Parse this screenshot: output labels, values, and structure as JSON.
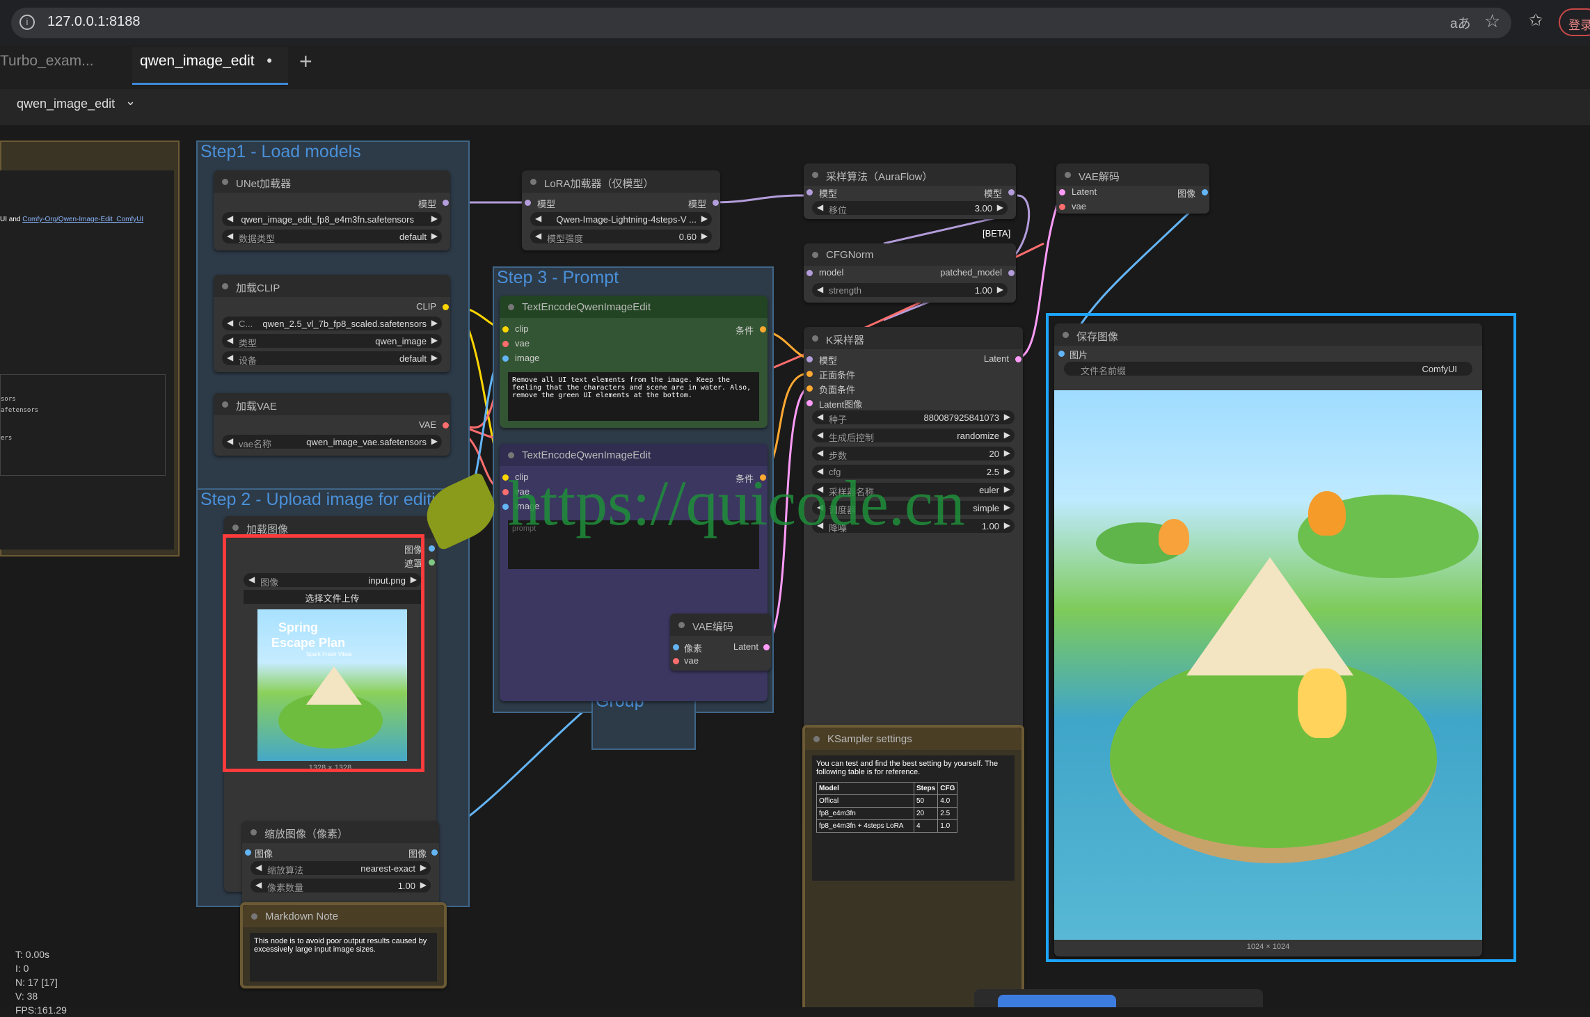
{
  "browser": {
    "url": "127.0.0.1:8188",
    "translate_icon": "aあ",
    "login_label": "登录"
  },
  "tabs": [
    {
      "label": "Turbo_exam..."
    },
    {
      "label": "qwen_image_edit",
      "dirty_mark": "●"
    }
  ],
  "new_tab_label": "+",
  "workflow_menu": {
    "label": "qwen_image_edit",
    "chevron": "⌄"
  },
  "groups": {
    "step1": "Step1 - Load models",
    "step2": "Step 2 - Upload image for editi",
    "step3": "Step 3 - Prompt",
    "group": "Group"
  },
  "left_note": {
    "text_before": "UI and ",
    "link": "Comfy-Org/Qwen-Image-Edit_ComfyUI",
    "lines": [
      "sors",
      "afetensors",
      "ers"
    ]
  },
  "unet": {
    "title": "UNet加载器",
    "out": "模型",
    "name_value": "qwen_image_edit_fp8_e4m3fn.safetensors",
    "dtype_label": "数据类型",
    "dtype_value": "default"
  },
  "clip_loader": {
    "title": "加载CLIP",
    "out": "CLIP",
    "name_label": "C...",
    "name_value": "qwen_2.5_vl_7b_fp8_scaled.safetensors",
    "type_label": "类型",
    "type_value": "qwen_image",
    "device_label": "设备",
    "device_value": "default"
  },
  "vae_loader": {
    "title": "加载VAE",
    "out": "VAE",
    "name_label": "vae名称",
    "name_value": "qwen_image_vae.safetensors"
  },
  "lora": {
    "title": "LoRA加载器（仅模型）",
    "in": "模型",
    "out": "模型",
    "name_value": "Qwen-Image-Lightning-4steps-V ...",
    "strength_label": "模型强度",
    "strength_value": "0.60"
  },
  "sampling": {
    "title": "采样算法（AuraFlow）",
    "in": "模型",
    "out": "模型",
    "shift_label": "移位",
    "shift_value": "3.00",
    "badge": "[BETA]"
  },
  "cfgnorm": {
    "title": "CFGNorm",
    "in": "model",
    "out": "patched_model",
    "strength_label": "strength",
    "strength_value": "1.00"
  },
  "vaedecode": {
    "title": "VAE解码",
    "in1": "Latent",
    "in2": "vae",
    "out": "图像"
  },
  "text1": {
    "title": "TextEncodeQwenImageEdit",
    "in1": "clip",
    "in2": "vae",
    "in3": "image",
    "out": "条件",
    "prompt": "Remove all UI text elements from the image. Keep the feeling that the characters and scene are in water. Also, remove the green UI elements at the bottom."
  },
  "text2": {
    "title": "TextEncodeQwenImageEdit",
    "in1": "clip",
    "in2": "vae",
    "in3": "image",
    "out": "条件",
    "placeholder": "prompt"
  },
  "ksampler": {
    "title": "K采样器",
    "in1": "模型",
    "in2": "正面条件",
    "in3": "负面条件",
    "in4": "Latent图像",
    "out": "Latent",
    "seed_label": "种子",
    "seed_value": "880087925841073",
    "control_label": "生成后控制",
    "control_value": "randomize",
    "steps_label": "步数",
    "steps_value": "20",
    "cfg_label": "cfg",
    "cfg_value": "2.5",
    "sampler_label": "采样器名称",
    "sampler_value": "euler",
    "scheduler_label": "调度器",
    "scheduler_value": "simple",
    "denoise_label": "降噪",
    "denoise_value": "1.00"
  },
  "save": {
    "title": "保存图像",
    "in": "图片",
    "prefix_label": "文件名前缀",
    "prefix_value": "ComfyUI",
    "size": "1024 × 1024"
  },
  "load_image": {
    "title": "加载图像",
    "out1": "图像",
    "out2": "遮罩",
    "image_label": "图像",
    "image_value": "input.png",
    "upload_label": "选择文件上传",
    "size": "1328 × 1328",
    "poster_title1": "Spring",
    "poster_title2": "Escape Plan",
    "poster_sub": "Spark Fresh Vibes"
  },
  "vaeencode": {
    "title": "VAE编码",
    "in1": "像素",
    "in2": "vae",
    "out": "Latent"
  },
  "scale": {
    "title": "缩放图像（像素）",
    "in": "图像",
    "out": "图像",
    "method_label": "缩放算法",
    "method_value": "nearest-exact",
    "mp_label": "像素数量",
    "mp_value": "1.00"
  },
  "ks_settings": {
    "title": "KSampler settings",
    "intro": "You can test and find the best setting by yourself. The following table is for reference.",
    "headers": [
      "Model",
      "Steps",
      "CFG"
    ],
    "rows": [
      [
        "Offical",
        "50",
        "4.0"
      ],
      [
        "fp8_e4m3fn",
        "20",
        "2.5"
      ],
      [
        "fp8_e4m3fn + 4steps LoRA",
        "4",
        "1.0"
      ]
    ]
  },
  "md_note": {
    "title": "Markdown Note",
    "text": "This node is to avoid poor output results caused by excessively large input image sizes."
  },
  "stats": {
    "t": "T: 0.00s",
    "i": "I: 0",
    "n": "N: 17 [17]",
    "v": "V: 38",
    "fps": "FPS:161.29"
  },
  "watermark": "https://quicode.cn",
  "colors": {
    "model": "#b39ddb",
    "clip": "#ffd500",
    "vae": "#ff6e6e",
    "image": "#64b5f6",
    "cond": "#ffa931",
    "latent": "#ff9cf9",
    "selected": "#1ca4ff",
    "error": "#ff3b3b"
  }
}
